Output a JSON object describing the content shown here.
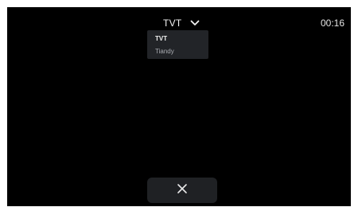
{
  "header": {
    "selected_source": "TVT",
    "dropdown_icon": "chevron-down-icon",
    "time": "00:16"
  },
  "dropdown": {
    "options": [
      {
        "label": "TVT",
        "selected": true
      },
      {
        "label": "Tiandy",
        "selected": false
      }
    ]
  },
  "footer": {
    "close_icon": "close-icon"
  },
  "colors": {
    "screen_background": "#000000",
    "panel_background": "#222428",
    "button_background": "#1f2124",
    "primary_text": "#f2f2f2",
    "secondary_text": "#a9acb2"
  }
}
